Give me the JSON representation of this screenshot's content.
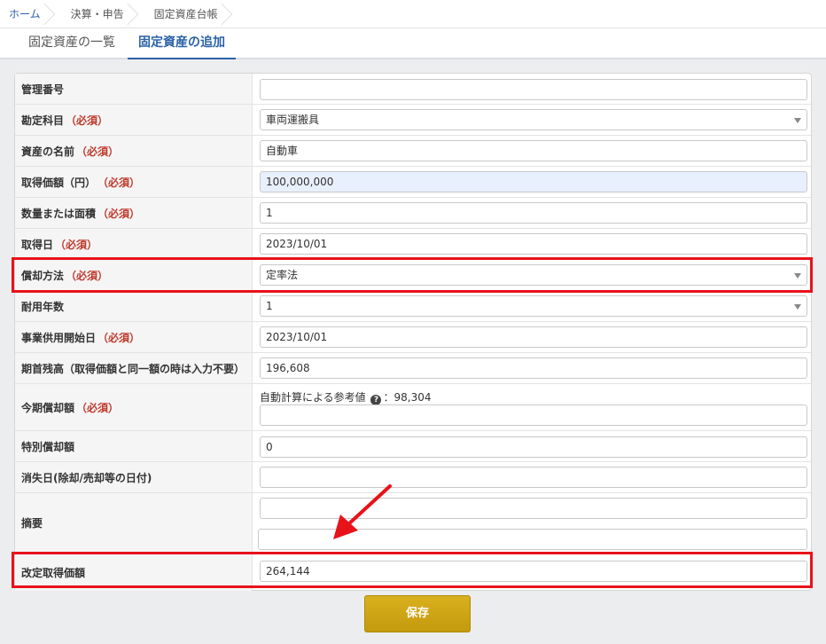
{
  "breadcrumb": [
    "ホーム",
    "決算・申告",
    "固定資産台帳"
  ],
  "tabs": [
    "固定資産の一覧",
    "固定資産の追加"
  ],
  "required_label": "（必須）",
  "form": {
    "management_number": {
      "label": "管理番号",
      "value": ""
    },
    "account": {
      "label": "勘定科目",
      "value": "車両運搬具"
    },
    "asset_name": {
      "label": "資産の名前",
      "value": "自動車"
    },
    "acquisition_cost": {
      "label": "取得価額（円）",
      "value": "100,000,000"
    },
    "quantity": {
      "label": "数量または面積",
      "value": "1"
    },
    "acquisition_date": {
      "label": "取得日",
      "value": "2023/10/01"
    },
    "depreciation_method": {
      "label": "償却方法",
      "value": "定率法"
    },
    "useful_life": {
      "label": "耐用年数",
      "value": "1"
    },
    "service_start_date": {
      "label": "事業供用開始日",
      "value": "2023/10/01"
    },
    "opening_balance": {
      "label": "期首残高（取得価額と同一額の時は入力不要）",
      "value": "196,608"
    },
    "current_depreciation": {
      "label": "今期償却額",
      "hint_prefix": "自動計算による参考値",
      "hint_value": "：98,304",
      "value": ""
    },
    "special_depreciation": {
      "label": "特別償却額",
      "value": "0"
    },
    "disposal_date": {
      "label": "消失日(除却/売却等の日付)",
      "value": ""
    },
    "memo": {
      "label": "摘要",
      "value1": "",
      "value2": ""
    },
    "revised_acquisition_cost": {
      "label": "改定取得価額",
      "value": "264,144"
    }
  },
  "save_label": "保存",
  "colors": {
    "accent": "#2b62a8",
    "required": "#c0392b",
    "highlight": "#e8121b",
    "save": "#c9a014"
  }
}
